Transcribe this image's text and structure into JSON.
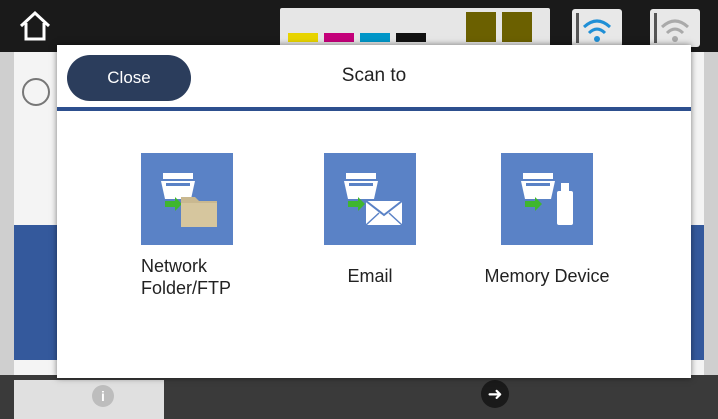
{
  "dialog": {
    "title": "Scan to",
    "close_label": "Close",
    "options": [
      {
        "label": "Network Folder/FTP",
        "line1": "Network",
        "line2": "Folder/FTP",
        "icon": "scanner-to-folder-icon"
      },
      {
        "label": "Email",
        "icon": "scanner-to-email-icon"
      },
      {
        "label": "Memory Device",
        "icon": "scanner-to-memory-device-icon"
      }
    ]
  },
  "colors": {
    "header_rule": "#2d4f8e",
    "tile": "#5a82c6",
    "close_button": "#2b3d5c",
    "arrow_green": "#3fb62f"
  }
}
